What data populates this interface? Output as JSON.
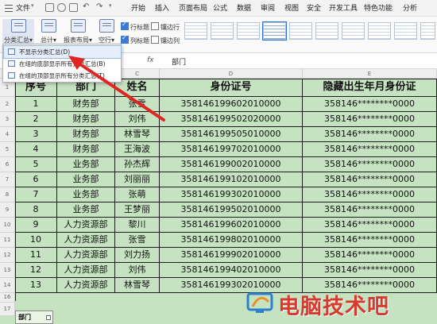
{
  "menubar": {
    "file": "文件",
    "tabs": [
      "开始",
      "插入",
      "页面布局",
      "公式",
      "数据",
      "审阅",
      "视图",
      "安全",
      "开发工具",
      "特色功能",
      "分析"
    ],
    "active_tab": "数据"
  },
  "ribbon": {
    "subtotal": "分类汇总",
    "total": "总计",
    "report_layout": "报表布局",
    "blank_row": "空行",
    "checkboxes": [
      "行标题",
      "列标题",
      "镶边行",
      "镶边列"
    ],
    "checkbox_states": [
      true,
      true,
      false,
      false
    ]
  },
  "formula": {
    "fx": "fx",
    "value": "部门"
  },
  "columns": [
    "A",
    "B",
    "C",
    "D",
    "E"
  ],
  "dropdown": {
    "items": [
      "不显示分类汇总(D)",
      "在组的底部显示所有分类汇总(B)",
      "在组的顶部显示所有分类汇总(T)"
    ],
    "highlighted": 0
  },
  "table": {
    "headers": [
      "序号",
      "部门",
      "姓名",
      "身份证号",
      "隐藏出生年月身份证"
    ],
    "rows": [
      [
        "1",
        "财务部",
        "张雪",
        "358146199602010000",
        "358146********0000"
      ],
      [
        "2",
        "财务部",
        "刘伟",
        "358146199502020000",
        "358146********0000"
      ],
      [
        "3",
        "财务部",
        "林雪琴",
        "358146199505010000",
        "358146********0000"
      ],
      [
        "4",
        "财务部",
        "王海波",
        "358146199702010000",
        "358146********0000"
      ],
      [
        "5",
        "业务部",
        "孙杰辉",
        "358146199002010000",
        "358146********0000"
      ],
      [
        "6",
        "业务部",
        "刘丽丽",
        "358146199102010000",
        "358146********0000"
      ],
      [
        "7",
        "业务部",
        "张萌",
        "358146199302010000",
        "358146********0000"
      ],
      [
        "8",
        "业务部",
        "王梦丽",
        "358146199502010000",
        "358146********0000"
      ],
      [
        "9",
        "人力资源部",
        "黎川",
        "358146199602010000",
        "358146********0000"
      ],
      [
        "10",
        "人力资源部",
        "张雪",
        "358146199802010000",
        "358146********0000"
      ],
      [
        "11",
        "人力资源部",
        "刘力扬",
        "358146199902010000",
        "358146********0000"
      ],
      [
        "12",
        "人力资源部",
        "刘伟",
        "358146199402010000",
        "358146********0000"
      ],
      [
        "13",
        "人力资源部",
        "林雪琴",
        "358146199302010000",
        "358146********0000"
      ]
    ],
    "row_numbers": [
      "2",
      "3",
      "4",
      "5",
      "6",
      "7",
      "8",
      "9",
      "10",
      "11",
      "12",
      "13",
      "14",
      "15",
      "16",
      "17"
    ],
    "header_row_number": "1",
    "footer_cell": "部门"
  },
  "watermark": "电脑技术吧",
  "colors": {
    "sheet_fill": "#c6e3c1",
    "accent": "#2a6fd6",
    "arrow": "#e02525",
    "watermark": "#d63a2f"
  }
}
